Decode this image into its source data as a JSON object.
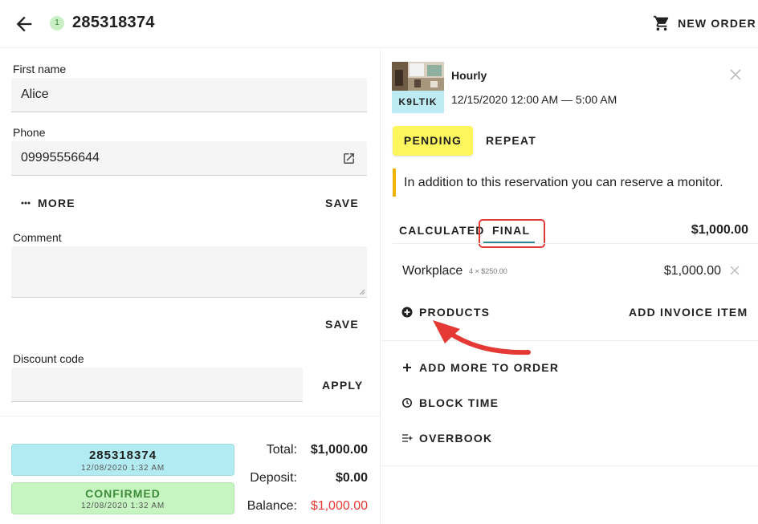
{
  "header": {
    "order_badge": "1",
    "order_number": "285318374",
    "new_order_label": "NEW ORDER"
  },
  "customer": {
    "first_name_label": "First name",
    "first_name_value": "Alice",
    "phone_label": "Phone",
    "phone_value": "09995556644",
    "more_label": "MORE",
    "save_label": "SAVE",
    "comment_label": "Comment",
    "comment_value": "",
    "comment_save_label": "SAVE",
    "discount_label": "Discount code",
    "discount_value": "",
    "apply_label": "APPLY"
  },
  "status": {
    "order_card_title": "285318374",
    "order_card_date": "12/08/2020 1:32 AM",
    "confirmed_title": "CONFIRMED",
    "confirmed_date": "12/08/2020 1:32 AM",
    "colors": {
      "order_card_bg": "#b3ebf2",
      "confirmed_bg": "#c6f5c2",
      "confirmed_text": "#3f8c3a"
    }
  },
  "totals": {
    "total_label": "Total:",
    "total_value": "$1,000.00",
    "deposit_label": "Deposit:",
    "deposit_value": "$0.00",
    "balance_label": "Balance:",
    "balance_value": "$1,000.00",
    "balance_color": "#e53935"
  },
  "reservation": {
    "code": "K9LTIK",
    "type": "Hourly",
    "time": "12/15/2020 12:00 AM — 5:00 AM",
    "pending_label": "PENDING",
    "repeat_label": "REPEAT",
    "notice": "In addition to this reservation you can reserve a monitor."
  },
  "pricing": {
    "tabs": [
      {
        "label": "CALCULATED",
        "active": false
      },
      {
        "label": "FINAL",
        "active": true
      }
    ],
    "total": "$1,000.00",
    "line_items": [
      {
        "name": "Workplace",
        "qty": "4 × $250.00",
        "amount": "$1,000.00"
      }
    ],
    "products_label": "PRODUCTS",
    "add_invoice_label": "ADD INVOICE ITEM"
  },
  "actions": {
    "add_more_label": "ADD MORE TO ORDER",
    "block_time_label": "BLOCK TIME",
    "overbook_label": "OVERBOOK"
  },
  "icons": {
    "back": "arrow-left-icon",
    "cart": "cart-icon",
    "external": "external-link-icon",
    "more": "more-dots-icon",
    "close": "close-icon",
    "products": "plus-circle-icon",
    "add_more": "plus-icon",
    "block_time": "clock-icon",
    "overbook": "overbook-icon"
  },
  "annotation": {
    "arrow_color": "#e53935"
  }
}
